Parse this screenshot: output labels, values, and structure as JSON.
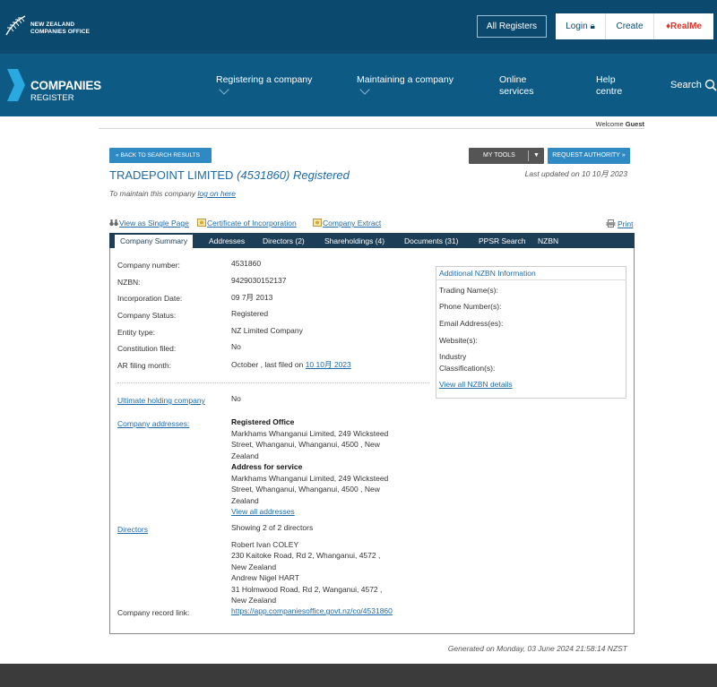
{
  "header": {
    "logo_line1": "NEW ZEALAND",
    "logo_line2": "COMPANIES OFFICE",
    "all_registers": "All Registers",
    "login": "Login",
    "create": "Create",
    "realme": "RealMe"
  },
  "nav": {
    "brand_title": "COMPANIES",
    "brand_sub": "REGISTER",
    "items": [
      {
        "label": "Registering a company"
      },
      {
        "label": "Maintaining a company"
      },
      {
        "label": "Online services"
      },
      {
        "label": "Help centre"
      }
    ],
    "search": "Search"
  },
  "welcome": {
    "prefix": "Welcome",
    "user": "Guest"
  },
  "toolbar": {
    "back": "BACK TO SEARCH RESULTS",
    "my_tools": "MY TOOLS",
    "request_authority": "REQUEST AUTHORITY"
  },
  "company": {
    "name": "TRADEPOINT LIMITED",
    "number_paren": "(4531860)",
    "status_word": "Registered",
    "last_updated": "Last updated on 10 10月 2023",
    "maintain_prefix": "To maintain this company",
    "maintain_link": "log on here"
  },
  "doc_links": {
    "single_page": "View as Single Page",
    "certificate": "Certificate of Incorporation",
    "extract": "Company Extract",
    "print": "Print"
  },
  "tabs": [
    {
      "label": "Company Summary"
    },
    {
      "label": "Addresses"
    },
    {
      "label": "Directors (2)"
    },
    {
      "label": "Shareholdings (4)"
    },
    {
      "label": "Documents (31)"
    },
    {
      "label": "PPSR Search"
    },
    {
      "label": "NZBN"
    }
  ],
  "summary": {
    "rows": [
      {
        "label": "Company number:",
        "value": "4531860"
      },
      {
        "label": "NZBN:",
        "value": "9429030152137"
      },
      {
        "label": "Incorporation Date:",
        "value": "09 7月 2013"
      },
      {
        "label": "Company Status:",
        "value": "Registered"
      },
      {
        "label": "Entity type:",
        "value": "NZ Limited Company"
      },
      {
        "label": "Constitution filed:",
        "value": "No"
      },
      {
        "label": "AR filing month:",
        "value": "October , last filed on",
        "link": "10 10月 2023"
      }
    ],
    "ultimate_label": "Ultimate holding company",
    "ultimate_value": "No",
    "addresses_label": "Company addresses:",
    "registered_office_heading": "Registered Office",
    "registered_office_1": "Markhams Whanganui Limited, 249 Wicksteed",
    "registered_office_2": "Street, Whanganui, Whanganui, 4500 , New",
    "registered_office_3": "Zealand",
    "service_heading": "Address for service",
    "service_1": "Markhams Whanganui Limited, 249 Wicksteed",
    "service_2": "Street, Whanganui, Whanganui, 4500 , New",
    "service_3": "Zealand",
    "view_all_addresses": "View all addresses",
    "directors_label": "Directors",
    "directors_showing": "Showing 2 of 2 directors",
    "director1_name": "Robert Ivan COLEY",
    "director1_addr1": "230 Kaitoke Road, Rd 2, Whanganui, 4572 ,",
    "director1_addr2": "New Zealand",
    "director2_name": "Andrew Nigel HART",
    "director2_addr1": "31 Holmwood Road, Rd 2, Wanganui, 4572 ,",
    "director2_addr2": "New Zealand",
    "record_link_label": "Company record link:",
    "record_link": "https://app.companiesoffice.govt.nz/co/4531860"
  },
  "nzbn": {
    "title": "Additional NZBN Information",
    "trading": "Trading Name(s):",
    "phone": "Phone Number(s):",
    "email": "Email Address(es):",
    "website": "Website(s):",
    "industry_1": "Industry",
    "industry_2": "Classification(s):",
    "view_all": "View all NZBN details"
  },
  "generated": "Generated on Monday, 03 June 2024 21:58:14 NZST",
  "colors": {
    "header": "#0b4a6e",
    "nav": "#0d5a85",
    "link": "#1f6aa8",
    "button": "#2f8ac3",
    "tabs": "#1d3e57",
    "footer": "#3b3b3b",
    "realme": "#d8362a"
  }
}
